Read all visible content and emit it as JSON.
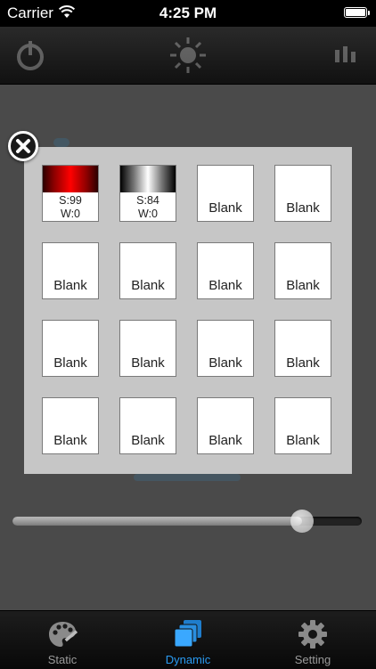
{
  "status_bar": {
    "carrier": "Carrier",
    "time": "4:25 PM"
  },
  "grid": {
    "presets": [
      {
        "label_s": "S:99",
        "label_w": "W:0",
        "swatch": "red"
      },
      {
        "label_s": "S:84",
        "label_w": "W:0",
        "swatch": "white"
      }
    ],
    "blank_label": "Blank",
    "blank_cells": [
      "Blank",
      "Blank",
      "Blank",
      "Blank",
      "Blank",
      "Blank",
      "Blank",
      "Blank",
      "Blank",
      "Blank",
      "Blank",
      "Blank",
      "Blank",
      "Blank"
    ]
  },
  "tabs": [
    {
      "label": "Static",
      "icon": "palette-icon",
      "active": false
    },
    {
      "label": "Dynamic",
      "icon": "stacked-squares-icon",
      "active": true
    },
    {
      "label": "Setting",
      "icon": "gear-icon",
      "active": false
    }
  ],
  "slider": {
    "value_fraction": 0.83
  },
  "colors": {
    "accent": "#2a9bf2",
    "panel": "#c6c6c6",
    "background": "#4a4a4a"
  }
}
